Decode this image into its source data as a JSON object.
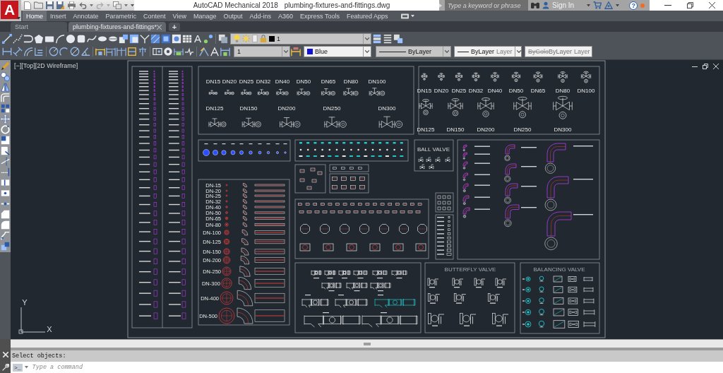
{
  "title_bar": {
    "logo": "A",
    "app_title": "AutoCAD Mechanical 2018",
    "file_name": "plumbing-fixtures-and-fittings.dwg",
    "search": {
      "placeholder": "Type a keyword or phrase"
    },
    "sign_in": "Sign In",
    "help": "?"
  },
  "ribbon_tabs": [
    {
      "label": "Home",
      "selected": true
    },
    {
      "label": "Insert",
      "selected": false
    },
    {
      "label": "Annotate",
      "selected": false
    },
    {
      "label": "Parametric",
      "selected": false
    },
    {
      "label": "Content",
      "selected": false
    },
    {
      "label": "View",
      "selected": false
    },
    {
      "label": "Manage",
      "selected": false
    },
    {
      "label": "Output",
      "selected": false
    },
    {
      "label": "Add-ins",
      "selected": false
    },
    {
      "label": "A360",
      "selected": false
    },
    {
      "label": "Express Tools",
      "selected": false
    },
    {
      "label": "Featured Apps",
      "selected": false
    }
  ],
  "document_tabs": [
    {
      "label": "Start",
      "selected": false
    },
    {
      "label": "plumbing-fixtures-and-fittings*",
      "selected": true
    }
  ],
  "new_tab": "+",
  "toolbar": {
    "text_tool": "A",
    "layer": "1",
    "dimension_style": "1",
    "colour_setting": "Blue",
    "linetype": "ByLayer",
    "lineweight": {
      "value": "ByLayer",
      "faded": "Layer"
    },
    "plot_style": {
      "struck": "ByColo",
      "value": "ByLayer",
      "faded": "Layer",
      "disabled": true
    }
  },
  "viewport": {
    "controls": [
      "[−]",
      "[Top]",
      "[2D Wireframe]"
    ],
    "ucs": {
      "x": "X",
      "y": "Y"
    }
  },
  "drawing": {
    "gate_valves": {
      "row_1": [
        "DN15",
        "DN20",
        "DN25",
        "DN32",
        "DN40",
        "DN50",
        "DN65",
        "DN80",
        "DN100"
      ],
      "row_2": [
        "DN125",
        "DN150",
        "DN200",
        "DN250",
        "DN300"
      ]
    },
    "globe_valves": {
      "row_1": [
        "DN15",
        "DN20",
        "DN25",
        "DN32",
        "DN40",
        "DN50",
        "DN65",
        "DN80",
        "DN100"
      ],
      "row_2": [
        "DN125",
        "DN150",
        "DN200",
        "DN250",
        "DN300"
      ]
    },
    "pipe_sizes": [
      "DN-15",
      "DN-20",
      "DN-25",
      "DN-32",
      "DN-40",
      "DN-50",
      "DN-65",
      "DN-80",
      "DN-100",
      "DN-125",
      "DN-150",
      "DN-200",
      "DN-250",
      "DN-300",
      "DN-400",
      "DN-500"
    ],
    "ball_valve_title": "BALL VALVE",
    "butterfly_valve_title": "BUTTERFLY VALVE",
    "balancing_valve_title": "BALANCING VALVE"
  },
  "command_line": {
    "history": "Select objects:",
    "prompt": ">_",
    "placeholder": "Type a command"
  }
}
